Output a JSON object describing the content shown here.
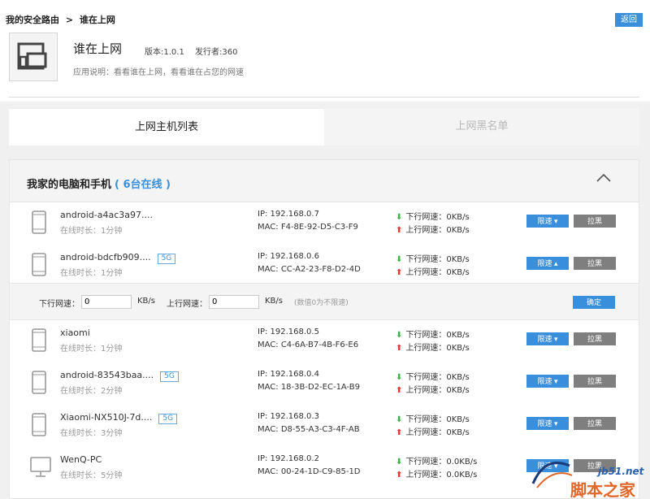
{
  "breadcrumb": {
    "root": "我的安全路由",
    "sep": ">",
    "current": "谁在上网"
  },
  "back_label": "返回",
  "app": {
    "title": "谁在上网",
    "version": "版本:1.0.1",
    "publisher": "发行者:360",
    "description": "应用说明：看看谁在上网，看看谁在占您的网速"
  },
  "tabs": [
    {
      "label": "上网主机列表",
      "active": true
    },
    {
      "label": "上网黑名单",
      "active": false
    }
  ],
  "group": {
    "title": "我家的电脑和手机",
    "count": "( 6台在线 )"
  },
  "buttons": {
    "limit": "限速 ▾",
    "limit_open": "限速 ▴",
    "block": "拉黑",
    "confirm": "确定"
  },
  "limit_panel": {
    "down_label": "下行网速：",
    "down_value": "0",
    "up_label": "上行网速：",
    "up_value": "0",
    "unit": "KB/s",
    "hint": "(数值0为不限速)"
  },
  "devices": [
    {
      "name": "android-a4ac3a97....",
      "tag": "",
      "time": "在线时长：1分钟",
      "ip": "IP: 192.168.0.7",
      "mac": "MAC: F4-8E-92-D5-C3-F9",
      "down": "下行网速：0KB/s",
      "up": "上行网速：0KB/s",
      "type": "phone"
    },
    {
      "name": "android-bdcfb909....",
      "tag": "5G",
      "time": "在线时长：1分钟",
      "ip": "IP: 192.168.0.6",
      "mac": "MAC: CC-A2-23-F8-D2-4D",
      "down": "下行网速：0KB/s",
      "up": "上行网速：0KB/s",
      "type": "phone"
    },
    {
      "name": "xiaomi",
      "tag": "",
      "time": "在线时长：1分钟",
      "ip": "IP: 192.168.0.5",
      "mac": "MAC: C4-6A-B7-4B-F6-E6",
      "down": "下行网速：0KB/s",
      "up": "上行网速：0KB/s",
      "type": "phone"
    },
    {
      "name": "android-83543baa....",
      "tag": "5G",
      "time": "在线时长：2分钟",
      "ip": "IP: 192.168.0.4",
      "mac": "MAC: 18-3B-D2-EC-1A-B9",
      "down": "下行网速：0KB/s",
      "up": "上行网速：0KB/s",
      "type": "phone"
    },
    {
      "name": "Xiaomi-NX510J-7d....",
      "tag": "5G",
      "time": "在线时长：3分钟",
      "ip": "IP: 192.168.0.3",
      "mac": "MAC: D8-55-A3-C3-4F-AB",
      "down": "下行网速：0KB/s",
      "up": "上行网速：0KB/s",
      "type": "phone"
    },
    {
      "name": "WenQ-PC",
      "tag": "",
      "time": "在线时长：5分钟",
      "ip": "IP: 192.168.0.2",
      "mac": "MAC: 00-24-1D-C9-85-1D",
      "down": "下行网速：0.0KB/s",
      "up": "上行网速：0.0KB/s",
      "type": "pc"
    }
  ],
  "watermark": {
    "site": "jb51.net",
    "name": "脚本之家"
  },
  "colors": {
    "accent": "#3a8fdc",
    "block": "#7f7f7f",
    "down_arrow": "#3bb44a",
    "up_arrow": "#e03a3a"
  }
}
